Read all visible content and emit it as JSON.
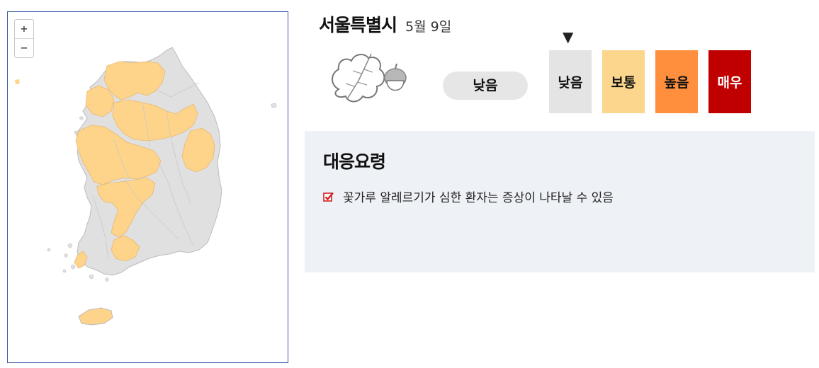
{
  "map": {
    "zoom_in_label": "+",
    "zoom_out_label": "−",
    "colors": {
      "low": "#e0e0e0",
      "normal": "#fed48a",
      "border": "#bcbcbc",
      "frame": "#3b5aa8"
    }
  },
  "header": {
    "city": "서울특별시",
    "date": "5월 9일"
  },
  "pollen": {
    "icon": "oak-leaf-acorn-icon",
    "current_level": "낮음",
    "scale": [
      {
        "label": "낮음",
        "color": "#e4e4e4"
      },
      {
        "label": "보통",
        "color": "#fbd68c"
      },
      {
        "label": "높음",
        "color": "#ff8f3d"
      },
      {
        "label": "매우",
        "color": "#c00000"
      }
    ],
    "indicator": "▼"
  },
  "guide": {
    "title": "대응요령",
    "items": [
      {
        "icon": "checkbox-checked-icon",
        "text": "꽃가루 알레르기가 심한 환자는 증상이 나타날 수 있음"
      }
    ]
  }
}
